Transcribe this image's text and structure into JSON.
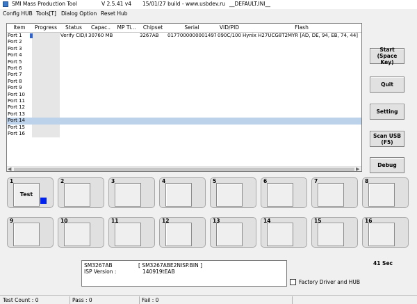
{
  "window": {
    "title": "SMI Mass Production Tool",
    "version": "V 2.5.41   v4",
    "build": "15/01/27 build - www.usbdev.ru",
    "ini": "__DEFAULT.INI__"
  },
  "menu": [
    "Config HUB",
    "Tools[T]",
    "Dialog Option",
    "Reset Hub"
  ],
  "list": {
    "headers": [
      "Item",
      "Progress",
      "Status",
      "Capac..",
      "MP Ti...",
      "Chipset",
      "Serial",
      "VID/PID",
      "Flash"
    ],
    "rows": [
      {
        "item": "Port 1",
        "status": "Verify CID/E",
        "capacity": "30760 MB",
        "chipset": "3267AB",
        "serial": "01770000000014977",
        "vidpid": "090C/1000",
        "flash": "Hynix H27UCG8T2MYR [AD, DE, 94, EB, 74, 44]"
      },
      {
        "item": "Port 2"
      },
      {
        "item": "Port 3"
      },
      {
        "item": "Port 4"
      },
      {
        "item": "Port 5"
      },
      {
        "item": "Port 6"
      },
      {
        "item": "Port 7"
      },
      {
        "item": "Port 8"
      },
      {
        "item": "Port 9"
      },
      {
        "item": "Port 10"
      },
      {
        "item": "Port 11"
      },
      {
        "item": "Port 12"
      },
      {
        "item": "Port 13"
      },
      {
        "item": "Port 14",
        "selected": true
      },
      {
        "item": "Port 15"
      },
      {
        "item": "Port 16"
      }
    ]
  },
  "buttons": [
    "Start\n(Space Key)",
    "Quit",
    "Setting",
    "Scan USB\n(F5)",
    "Debug"
  ],
  "ports": [
    {
      "num": "1",
      "label": "Test",
      "indicator": "#0022ee"
    },
    {
      "num": "2"
    },
    {
      "num": "3"
    },
    {
      "num": "4"
    },
    {
      "num": "5"
    },
    {
      "num": "6"
    },
    {
      "num": "7"
    },
    {
      "num": "8"
    },
    {
      "num": "9"
    },
    {
      "num": "10"
    },
    {
      "num": "11"
    },
    {
      "num": "12"
    },
    {
      "num": "13"
    },
    {
      "num": "14"
    },
    {
      "num": "15"
    },
    {
      "num": "16"
    }
  ],
  "info": {
    "line1_label": "SM3267AB",
    "line1_value": "[ SM3267ABE2NISP.BIN ]",
    "line2_label": "ISP Version :",
    "line2_value": "140919tEAB"
  },
  "timer": "41 Sec",
  "factory_driver": {
    "label": "Factory Driver and HUB",
    "checked": false
  },
  "status": {
    "test_count": "Test Count : 0",
    "pass": "Pass : 0",
    "fail": "Fail : 0"
  }
}
